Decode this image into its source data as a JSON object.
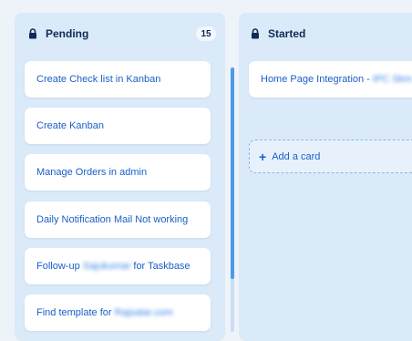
{
  "columns": [
    {
      "title": "Pending",
      "count": "15",
      "cards": [
        {
          "text": "Create Check list in Kanban"
        },
        {
          "text": "Create Kanban"
        },
        {
          "text": "Manage Orders in admin"
        },
        {
          "text": "Daily Notification Mail Not working"
        },
        {
          "prefix": "Follow-up ",
          "blurred": "Sajukumar",
          "suffix": " for Taskbase"
        },
        {
          "prefix": "Find template for ",
          "blurred": "Rajsatar.com",
          "suffix": ""
        }
      ]
    },
    {
      "title": "Started",
      "cards": [
        {
          "prefix": "Home Page Integration - ",
          "blurred": "IPC Skm"
        }
      ],
      "add_card_label": "Add a card"
    }
  ],
  "colors": {
    "board_bg": "#eef3f9",
    "column_bg": "#dbeaf9",
    "card_text": "#1a5fc9",
    "header_text": "#0e2a55",
    "scroll_thumb": "#4a9af0"
  },
  "icons": {
    "lock": "lock-icon",
    "plus": "plus-icon"
  }
}
